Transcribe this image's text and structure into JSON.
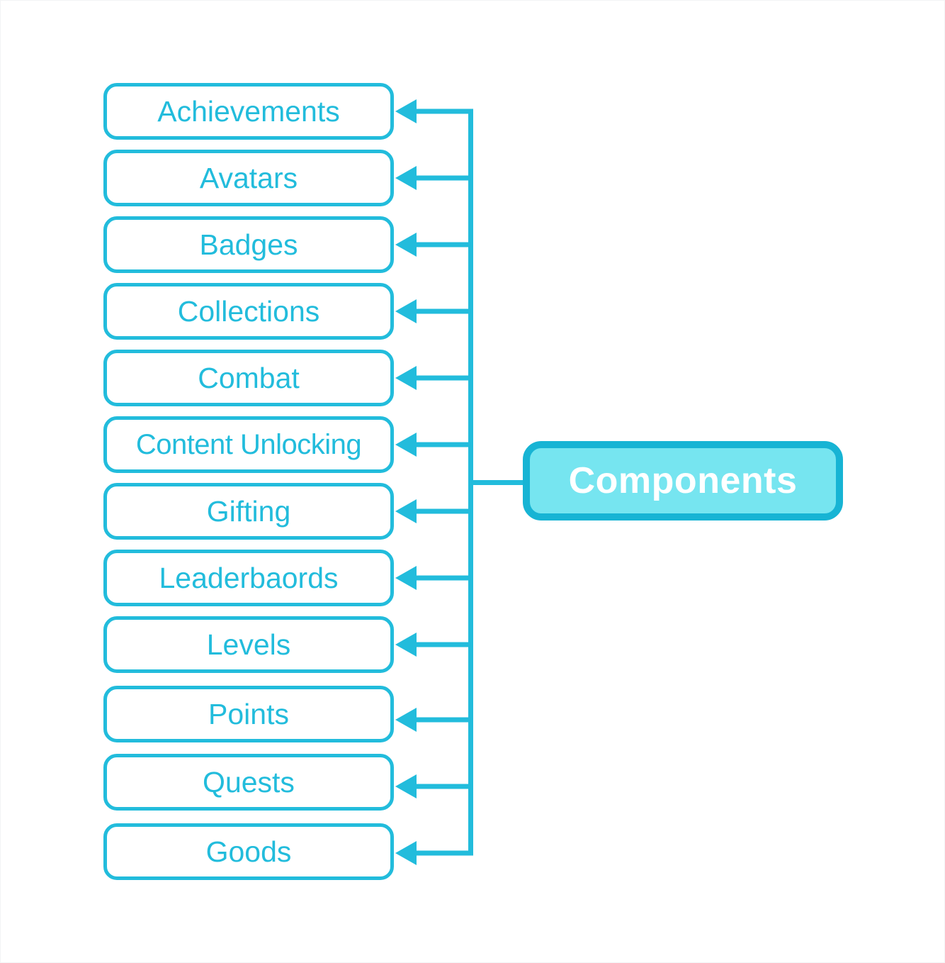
{
  "diagram": {
    "title": "Components",
    "type": "mind-map",
    "root": {
      "label": "Components",
      "fill_color": "#76E5F0",
      "border_color": "#17B4D4",
      "text_color": "#FFFFFF"
    },
    "accent_color": "#22BCDC",
    "background_color": "#FFFFFF",
    "children": [
      {
        "label": "Achievements"
      },
      {
        "label": "Avatars"
      },
      {
        "label": "Badges"
      },
      {
        "label": "Collections"
      },
      {
        "label": "Combat"
      },
      {
        "label": "Content Unlocking"
      },
      {
        "label": "Gifting"
      },
      {
        "label": "Leaderbaords"
      },
      {
        "label": "Levels"
      },
      {
        "label": "Points"
      },
      {
        "label": "Quests"
      },
      {
        "label": "Goods"
      }
    ]
  }
}
